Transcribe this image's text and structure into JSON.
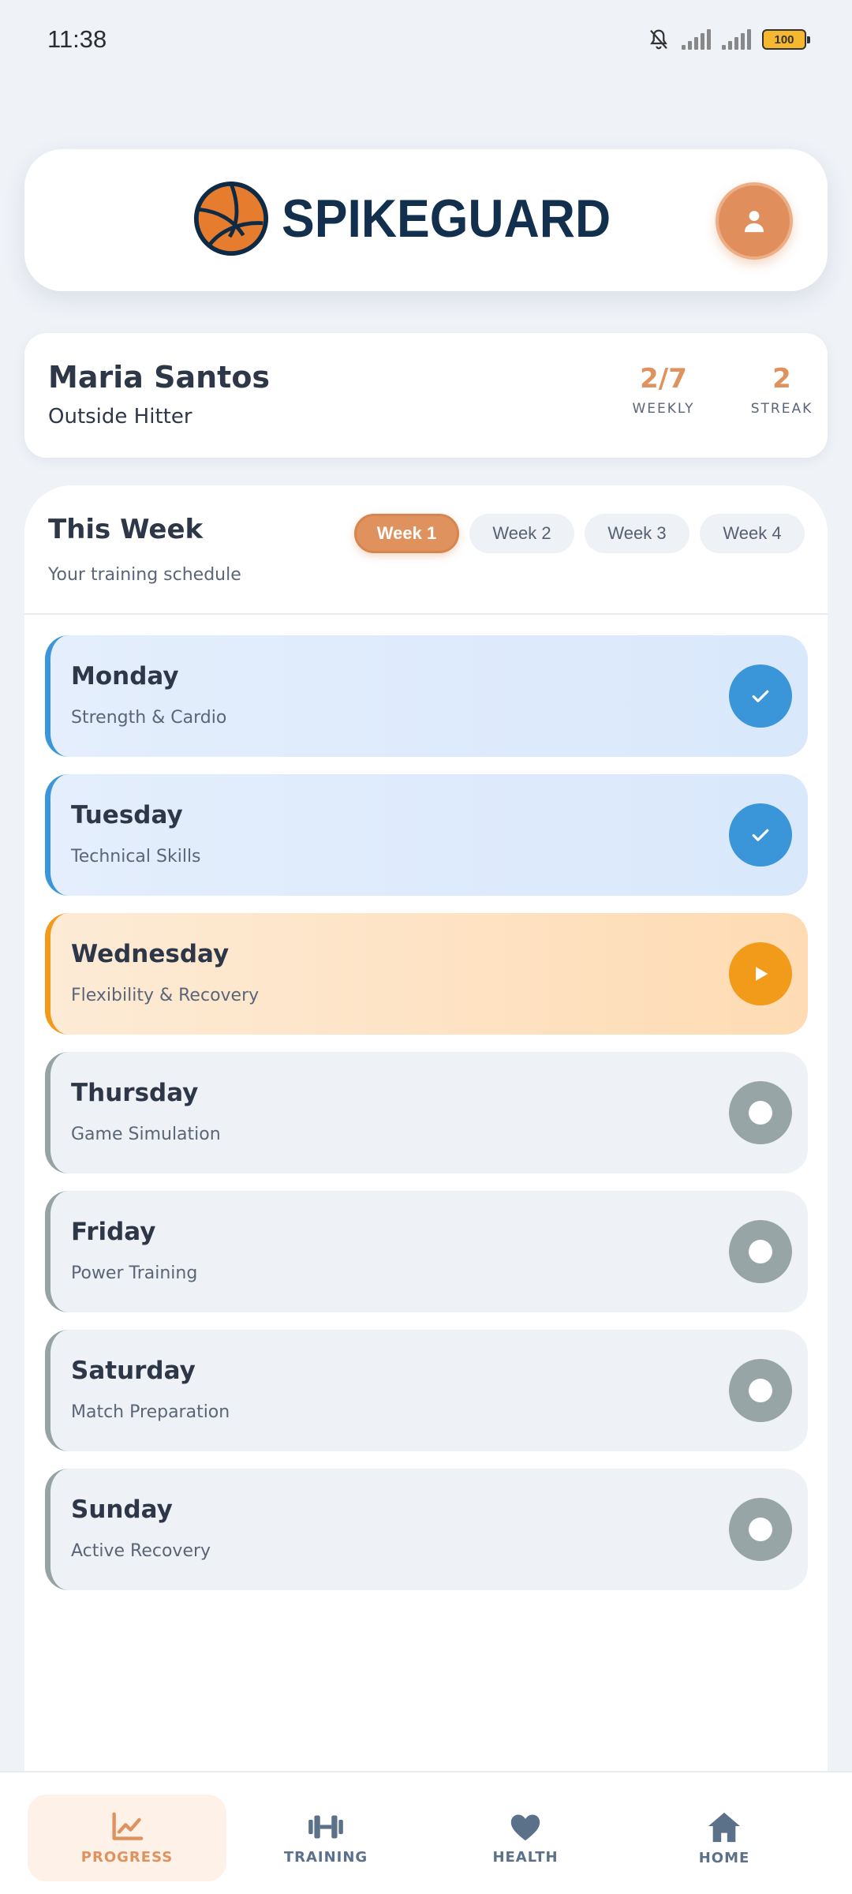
{
  "status_bar": {
    "time": "11:38",
    "battery": "100"
  },
  "header": {
    "app_name": "SPIKEGUARD",
    "logo_icon": "volleyball-icon",
    "avatar_icon": "user-icon"
  },
  "profile": {
    "name": "Maria Santos",
    "role": "Outside Hitter",
    "stats": [
      {
        "value": "2/7",
        "label": "WEEKLY"
      },
      {
        "value": "2",
        "label": "STREAK"
      }
    ]
  },
  "schedule": {
    "title": "This Week",
    "subtitle": "Your training schedule",
    "tabs": [
      {
        "label": "Week 1",
        "active": true
      },
      {
        "label": "Week 2",
        "active": false
      },
      {
        "label": "Week 3",
        "active": false
      },
      {
        "label": "Week 4",
        "active": false
      }
    ],
    "days": [
      {
        "day": "Monday",
        "focus": "Strength & Cardio",
        "status": "done"
      },
      {
        "day": "Tuesday",
        "focus": "Technical Skills",
        "status": "done"
      },
      {
        "day": "Wednesday",
        "focus": "Flexibility & Recovery",
        "status": "current"
      },
      {
        "day": "Thursday",
        "focus": "Game Simulation",
        "status": "upcoming"
      },
      {
        "day": "Friday",
        "focus": "Power Training",
        "status": "upcoming"
      },
      {
        "day": "Saturday",
        "focus": "Match Preparation",
        "status": "upcoming"
      },
      {
        "day": "Sunday",
        "focus": "Active Recovery",
        "status": "upcoming"
      }
    ]
  },
  "nav": {
    "items": [
      {
        "label": "PROGRESS",
        "icon": "chart-line-icon",
        "active": true
      },
      {
        "label": "TRAINING",
        "icon": "dumbbell-icon",
        "active": false
      },
      {
        "label": "HEALTH",
        "icon": "heart-icon",
        "active": false
      },
      {
        "label": "HOME",
        "icon": "home-icon",
        "active": false
      }
    ]
  },
  "colors": {
    "accent": "#e0925e",
    "done": "#3a95d9",
    "current": "#f29a1a",
    "upcoming": "#97a5a6",
    "logo_text": "#12304d"
  }
}
